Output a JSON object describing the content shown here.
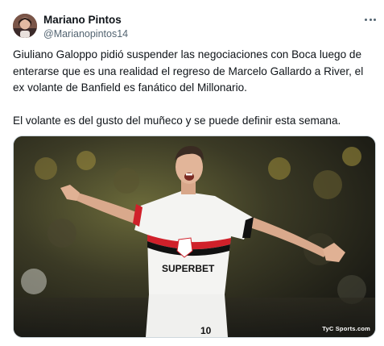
{
  "author": {
    "name": "Mariano Pintos",
    "handle": "@Marianopintos14"
  },
  "tweet": {
    "lines_p1": [
      "Giuliano Galoppo pidió suspender las negociaciones con Boca luego de",
      "enterarse que es una realidad el regreso de Marcelo Gallardo a River, el",
      "ex volante de Banfield es fanático del Millonario."
    ],
    "line_p2": "El volante es del gusto del muñeco y se puede definir esta semana."
  },
  "media": {
    "shirt_sponsor": "SUPERBET",
    "shirt_number": "10",
    "watermark": "TyC Sports.com"
  },
  "icons": {
    "more": "more-options-icon"
  },
  "colors": {
    "text": "#0f1419",
    "secondary": "#536471",
    "border": "#cfd9de",
    "stripe_red": "#d0202a"
  }
}
